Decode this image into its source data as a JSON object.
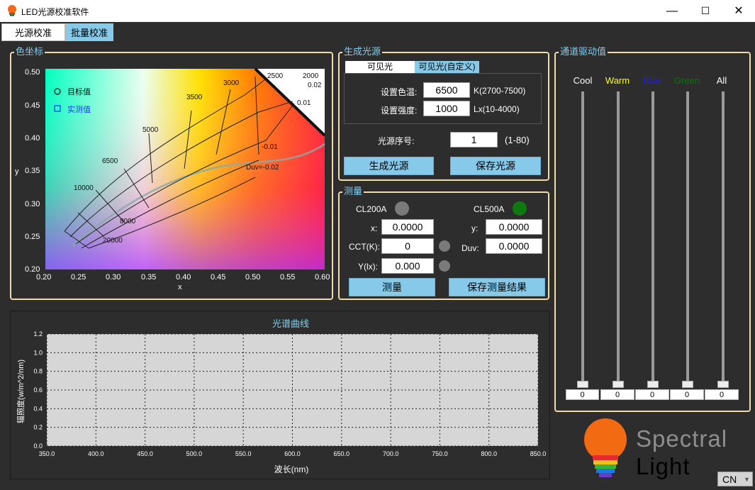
{
  "window": {
    "title": "LED光源校准软件",
    "min": "—",
    "max": "☐",
    "close": "✕"
  },
  "tabs": [
    "光源校准",
    "批量校准"
  ],
  "color_coord": {
    "title": "色坐标",
    "legend_target": "目标值",
    "legend_measured": "实测值",
    "xlabel": "x",
    "ylabel": "y",
    "xticks": [
      "0.20",
      "0.25",
      "0.30",
      "0.35",
      "0.40",
      "0.45",
      "0.50",
      "0.55",
      "0.60"
    ],
    "yticks": [
      "0.50",
      "0.45",
      "0.40",
      "0.35",
      "0.30",
      "0.25",
      "0.20"
    ],
    "cct_labels": [
      "2500",
      "2000",
      "3000",
      "3500",
      "5000",
      "6500",
      "10000",
      "8000",
      "20000"
    ],
    "duv_labels": [
      "0.02",
      "0.01",
      "-0.01",
      "Duv=-0.02"
    ]
  },
  "gen": {
    "title": "生成光源",
    "tab_visible": "可见光",
    "tab_custom": "可见光(自定义)",
    "cct_label": "设置色温:",
    "cct_value": "6500",
    "cct_range": "K(2700-7500)",
    "int_label": "设置强度:",
    "int_value": "1000",
    "int_range": "Lx(10-4000)",
    "idx_label": "光源序号:",
    "idx_value": "1",
    "idx_range": "(1-80)",
    "btn_generate": "生成光源",
    "btn_save": "保存光源"
  },
  "measure": {
    "title": "测量",
    "dev1": "CL200A",
    "dev2": "CL500A",
    "x_label": "x:",
    "x_value": "0.0000",
    "y_label": "y:",
    "y_value": "0.0000",
    "cct_label": "CCT(K):",
    "cct_value": "0",
    "duv_label": "Duv:",
    "duv_value": "0.0000",
    "lux_label": "Y(lx):",
    "lux_value": "0.000",
    "btn_measure": "测量",
    "btn_save": "保存测量结果",
    "colors": {
      "led_off": "#7a7a7a",
      "led_on": "#0e7a0e"
    }
  },
  "drive": {
    "title": "通道驱动值",
    "channels": [
      {
        "name": "Cool",
        "color": "#ffffff",
        "value": "0"
      },
      {
        "name": "Warm",
        "color": "#ffff00",
        "value": "0"
      },
      {
        "name": "Blue",
        "color": "#1a1aff",
        "value": "0"
      },
      {
        "name": "Green",
        "color": "#007a00",
        "value": "0"
      },
      {
        "name": "All",
        "color": "#ffffff",
        "value": "0"
      }
    ]
  },
  "chart_data": {
    "type": "line",
    "title": "光谱曲线",
    "xlabel": "波长(nm)",
    "ylabel": "辐照度(w/m^2/nm)",
    "xlim": [
      350,
      850
    ],
    "ylim": [
      0,
      1.2
    ],
    "xticks": [
      "350.0",
      "400.0",
      "450.0",
      "500.0",
      "550.0",
      "600.0",
      "650.0",
      "700.0",
      "750.0",
      "800.0",
      "850.0"
    ],
    "yticks": [
      "1.2",
      "1.0",
      "0.8",
      "0.6",
      "0.4",
      "0.2",
      "0.0"
    ],
    "grid": true,
    "series": []
  },
  "brand": {
    "line1": "Spectral",
    "line2": "Light"
  },
  "lang": "CN"
}
